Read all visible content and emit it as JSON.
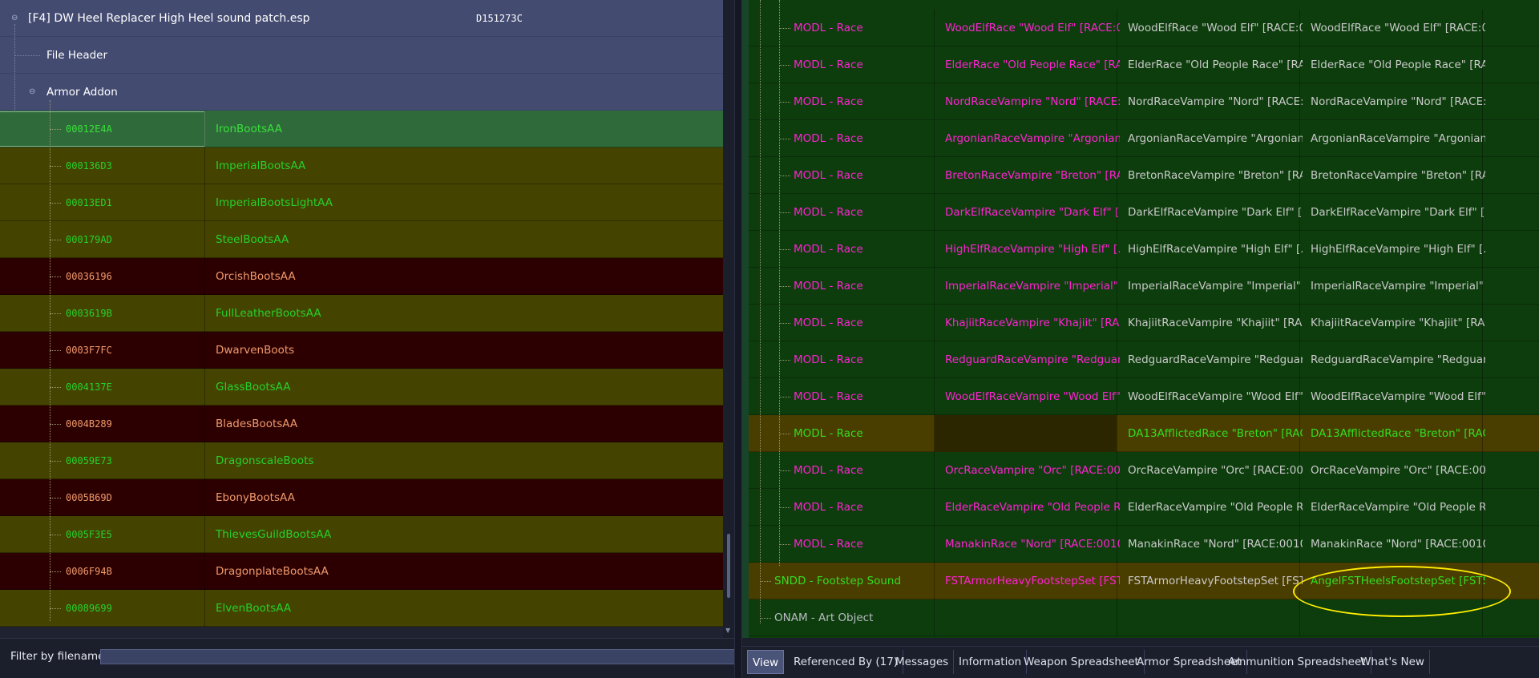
{
  "left": {
    "plugin": {
      "name": "[F4] DW Heel Replacer High Heel sound patch.esp",
      "crc": "D151273C"
    },
    "file_header": "File Header",
    "group": "Armor Addon",
    "records": [
      {
        "formid": "00012E4A",
        "editor_id": "IronBootsAA",
        "state": "selected"
      },
      {
        "formid": "000136D3",
        "editor_id": "ImperialBootsAA",
        "state": "green"
      },
      {
        "formid": "00013ED1",
        "editor_id": "ImperialBootsLightAA",
        "state": "green"
      },
      {
        "formid": "000179AD",
        "editor_id": "SteelBootsAA",
        "state": "green"
      },
      {
        "formid": "00036196",
        "editor_id": "OrcishBootsAA",
        "state": "red"
      },
      {
        "formid": "0003619B",
        "editor_id": "FullLeatherBootsAA",
        "state": "green"
      },
      {
        "formid": "0003F7FC",
        "editor_id": "DwarvenBoots",
        "state": "red"
      },
      {
        "formid": "0004137E",
        "editor_id": "GlassBootsAA",
        "state": "green"
      },
      {
        "formid": "0004B289",
        "editor_id": "BladesBootsAA",
        "state": "red"
      },
      {
        "formid": "00059E73",
        "editor_id": "DragonscaleBoots",
        "state": "green"
      },
      {
        "formid": "0005B69D",
        "editor_id": "EbonyBootsAA",
        "state": "red"
      },
      {
        "formid": "0005F3E5",
        "editor_id": "ThievesGuildBootsAA",
        "state": "green"
      },
      {
        "formid": "0006F94B",
        "editor_id": "DragonplateBootsAA",
        "state": "red"
      },
      {
        "formid": "00089699",
        "editor_id": "ElvenBootsAA",
        "state": "green"
      }
    ],
    "filter": {
      "label": "Filter by filename:",
      "value": ""
    }
  },
  "right": {
    "rows": [
      {
        "field": "MODL - Race",
        "v1": "WoodElfRace \"Wood Elf\" [RACE:0...",
        "v2": "WoodElfRace \"Wood Elf\" [RACE:0...",
        "v3": "WoodElfRace \"Wood Elf\" [RACE:0...",
        "kind": "norm"
      },
      {
        "field": "MODL - Race",
        "v1": "ElderRace \"Old People Race\" [RA...",
        "v2": "ElderRace \"Old People Race\" [RA...",
        "v3": "ElderRace \"Old People Race\" [RA...",
        "kind": "norm"
      },
      {
        "field": "MODL - Race",
        "v1": "NordRaceVampire \"Nord\" [RACE:...",
        "v2": "NordRaceVampire \"Nord\" [RACE:...",
        "v3": "NordRaceVampire \"Nord\" [RACE:...",
        "kind": "norm"
      },
      {
        "field": "MODL - Race",
        "v1": "ArgonianRaceVampire \"Argonian...",
        "v2": "ArgonianRaceVampire \"Argonian...",
        "v3": "ArgonianRaceVampire \"Argonian...",
        "kind": "norm"
      },
      {
        "field": "MODL - Race",
        "v1": "BretonRaceVampire \"Breton\" [RA...",
        "v2": "BretonRaceVampire \"Breton\" [RA...",
        "v3": "BretonRaceVampire \"Breton\" [RA...",
        "kind": "norm"
      },
      {
        "field": "MODL - Race",
        "v1": "DarkElfRaceVampire \"Dark Elf\" [R...",
        "v2": "DarkElfRaceVampire \"Dark Elf\" [R...",
        "v3": "DarkElfRaceVampire \"Dark Elf\" [R...",
        "kind": "norm"
      },
      {
        "field": "MODL - Race",
        "v1": "HighElfRaceVampire \"High Elf\" [...",
        "v2": "HighElfRaceVampire \"High Elf\" [...",
        "v3": "HighElfRaceVampire \"High Elf\" [...",
        "kind": "norm"
      },
      {
        "field": "MODL - Race",
        "v1": "ImperialRaceVampire \"Imperial\" [...",
        "v2": "ImperialRaceVampire \"Imperial\" [...",
        "v3": "ImperialRaceVampire \"Imperial\" [...",
        "kind": "norm"
      },
      {
        "field": "MODL - Race",
        "v1": "KhajiitRaceVampire \"Khajiit\" [RA...",
        "v2": "KhajiitRaceVampire \"Khajiit\" [RA...",
        "v3": "KhajiitRaceVampire \"Khajiit\" [RA...",
        "kind": "norm"
      },
      {
        "field": "MODL - Race",
        "v1": "RedguardRaceVampire \"Redguar...",
        "v2": "RedguardRaceVampire \"Redguar...",
        "v3": "RedguardRaceVampire \"Redguar...",
        "kind": "norm"
      },
      {
        "field": "MODL - Race",
        "v1": "WoodElfRaceVampire \"Wood Elf\"...",
        "v2": "WoodElfRaceVampire \"Wood Elf\"...",
        "v3": "WoodElfRaceVampire \"Wood Elf\"...",
        "kind": "norm"
      },
      {
        "field": "MODL - Race",
        "v1": "",
        "v2": "DA13AfflictedRace \"Breton\" [RAC...",
        "v3": "DA13AfflictedRace \"Breton\" [RAC...",
        "kind": "conf"
      },
      {
        "field": "MODL - Race",
        "v1": "OrcRaceVampire \"Orc\" [RACE:000...",
        "v2": "OrcRaceVampire \"Orc\" [RACE:000...",
        "v3": "OrcRaceVampire \"Orc\" [RACE:000...",
        "kind": "norm"
      },
      {
        "field": "MODL - Race",
        "v1": "ElderRaceVampire \"Old People R...",
        "v2": "ElderRaceVampire \"Old People R...",
        "v3": "ElderRaceVampire \"Old People R...",
        "kind": "norm"
      },
      {
        "field": "MODL - Race",
        "v1": "ManakinRace \"Nord\" [RACE:0010...",
        "v2": "ManakinRace \"Nord\" [RACE:0010...",
        "v3": "ManakinRace \"Nord\" [RACE:0010...",
        "kind": "norm"
      },
      {
        "field": "SNDD - Footstep Sound",
        "v1": "FSTArmorHeavyFootstepSet [FST...",
        "v2": "FSTArmorHeavyFootstepSet [FST...",
        "v3": "AngelFSTHeelsFootstepSet [FSTS...",
        "kind": "sndd"
      },
      {
        "field": "ONAM - Art Object",
        "v1": "",
        "v2": "",
        "v3": "",
        "kind": "onam"
      }
    ]
  },
  "tabs": [
    {
      "label": "View",
      "active": true
    },
    {
      "label": "Referenced By (17)"
    },
    {
      "label": "Messages"
    },
    {
      "label": "Information"
    },
    {
      "label": "Weapon Spreadsheet"
    },
    {
      "label": "Armor Spreadsheet"
    },
    {
      "label": "Ammunition Spreadsheet"
    },
    {
      "label": "What's New"
    }
  ]
}
